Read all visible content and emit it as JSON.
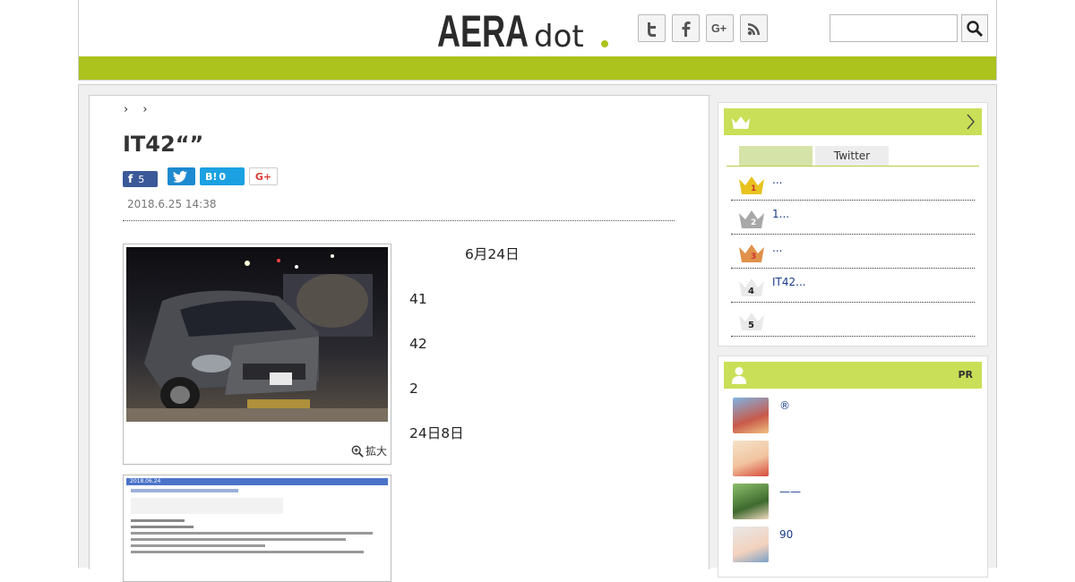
{
  "header": {
    "logo_text": "AERA dot.",
    "social_icons": [
      "twitter-icon",
      "facebook-icon",
      "google-plus-icon",
      "rss-icon"
    ],
    "search": {
      "value": "",
      "placeholder": ""
    },
    "colors": {
      "accent": "#acc21d",
      "panel_head": "#c9df57"
    }
  },
  "article": {
    "breadcrumb_arrows": "› ›",
    "title": "IT42“”",
    "share": {
      "facebook_count": "5",
      "hatena_label": "B!",
      "hatena_count": "0",
      "gplus_label": "G+"
    },
    "date": "2018.6.25 14:38",
    "photo_zoom_label": "拡大",
    "paragraphs": [
      "　　　　6月24日",
      "41",
      "42",
      "2",
      "24日8日"
    ],
    "link_text": "",
    "screenshot_header": "2018.06.24"
  },
  "sidebar": {
    "ranking": {
      "tabs": [
        "",
        "Twitter"
      ],
      "items": [
        {
          "rank": "1",
          "text": "..."
        },
        {
          "rank": "2",
          "text": "1..."
        },
        {
          "rank": "3",
          "text": "..."
        },
        {
          "rank": "4",
          "text": "IT42..."
        },
        {
          "rank": "5",
          "text": ""
        }
      ]
    },
    "pr": {
      "label": "PR",
      "items": [
        {
          "text": "®"
        },
        {
          "text": ""
        },
        {
          "text": "——"
        },
        {
          "text": "90"
        }
      ]
    }
  }
}
